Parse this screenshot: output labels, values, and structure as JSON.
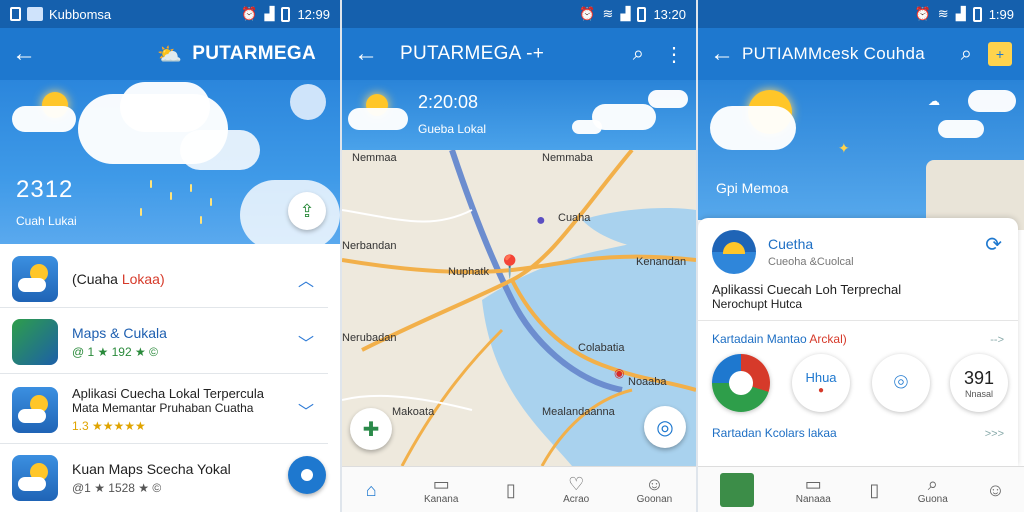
{
  "screen1": {
    "status": {
      "app": "Kubbomsa",
      "time": "12:99"
    },
    "appbar": {
      "title": "PUTARMEGA"
    },
    "hero": {
      "temp": "2312",
      "location": "Cuah Lukai"
    },
    "items": [
      {
        "title_prefix": "(Cuaha ",
        "title_red": "Lokaa)",
        "sub": ""
      },
      {
        "title": "Maps & Cukala",
        "sub": "@ 1 ★ 192 ★ ©"
      },
      {
        "title": "Aplikasi Cuecha Lokal Terpercula",
        "title2": "Mata Memantar Pruhaban Cuatha",
        "sub": "1.3 ★★★★★"
      },
      {
        "title": "Kuan Maps  Scecha Yokal",
        "sub": "@1 ★ 1528 ★ ©"
      }
    ]
  },
  "screen2": {
    "status": {
      "time": "13:20"
    },
    "appbar": {
      "title": "PUTARMEGA -+"
    },
    "hero": {
      "time": "2:20:08",
      "location": "Gueba Lokal"
    },
    "map_labels": [
      "Nemmaa",
      "Nemmaba",
      "Cuaha",
      "Nerbandan",
      "Nuphatk",
      "Kenandan",
      "Nerubadan",
      "Colabatia",
      "Noaaba",
      "Makoata",
      "Mealandaanna"
    ],
    "nav": [
      "",
      "Kanana",
      "",
      "Acrao",
      "Goonan"
    ]
  },
  "screen3": {
    "status": {
      "time": "1:99"
    },
    "appbar": {
      "title": "PUTIAMMcesk Couhda"
    },
    "hero": {
      "location": "Gpi Memoa"
    },
    "card": {
      "name": "Cuetha",
      "sub": "Cueoha &Cuolcal",
      "desc1": "Aplikassi Cuecah Loh Terprechal",
      "desc2": "Nerochupt Hutca",
      "section1_prefix": "Kartadain Mantao ",
      "section1_red": "Arckal)",
      "section1_arrow": "-->",
      "circle_pct": "Hhua",
      "circle_num": "391",
      "circle_cap": "Nnasal",
      "section2": "Rartadan Kcolars lakaa",
      "section2_arrow": ">>>"
    },
    "nav": [
      "",
      "Nanaaa",
      "",
      "Guona",
      ""
    ]
  }
}
